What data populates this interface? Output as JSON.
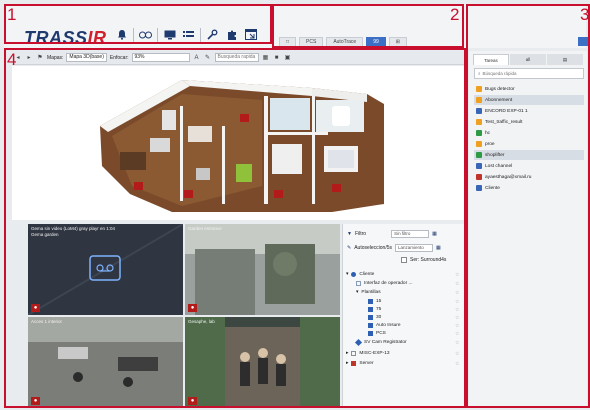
{
  "regions": {
    "r1": "1",
    "r2": "2",
    "r3": "3",
    "r4": "4"
  },
  "brand": {
    "logo_a": "TRASS",
    "logo_b": "IR"
  },
  "toolbar_icons": [
    "bell-icon",
    "link-icon",
    "monitor-icon",
    "list-icon",
    "wrench-icon",
    "puzzle-icon",
    "window-icon"
  ],
  "view_tabs": [
    {
      "label": "□",
      "active": false
    },
    {
      "label": "PCS",
      "active": false
    },
    {
      "label": "AutoTrace",
      "active": false
    },
    {
      "label": "99",
      "active": true
    },
    {
      "label": "⊞",
      "active": false
    }
  ],
  "viewbar": {
    "map_label": "Mapas:",
    "map_value": "Mapa 3D(base)",
    "scale_label": "Enfocar:",
    "scale_value": "93%",
    "search_placeholder": "Busqueda rapida"
  },
  "cameras": [
    {
      "title": "Gema sin video (LoM4) gray playr en 1:04",
      "subtitle": "Gema garden",
      "bg": "#2f3541"
    },
    {
      "title": "Garden entrance",
      "bg": "#7e8387"
    },
    {
      "title": "Acces 1 interior",
      "bg": "#6d6f6a"
    },
    {
      "title": "Gesaphe, lab",
      "bg": "#3c4741"
    }
  ],
  "filter": {
    "filter_label": "Filtro",
    "filter_value": "Sin filtro",
    "auto_label": "Autoseleccion/5s",
    "auto_value": "Lanzamiento",
    "checkbox_label": "Ser: Surround4s"
  },
  "tree": [
    {
      "label": "Cliente",
      "level": 0,
      "icon": "#2f5fb3"
    },
    {
      "label": "Interfaz de operador ...",
      "level": 1,
      "icon": "#8a9bb8"
    },
    {
      "label": "Plantillas",
      "level": 1,
      "icon": "#2f5fb3"
    },
    {
      "label": "15",
      "level": 2,
      "icon": "#2f5fb3"
    },
    {
      "label": "75",
      "level": 2,
      "icon": "#2f5fb3"
    },
    {
      "label": "30",
      "level": 2,
      "icon": "#2f5fb3"
    },
    {
      "label": "Auto Insure",
      "level": 2,
      "icon": "#2f5fb3"
    },
    {
      "label": "PCS",
      "level": 2,
      "icon": "#2f5fb3"
    },
    {
      "label": "SV Cam Registrator",
      "level": 1,
      "icon": "#2f5fb3"
    },
    {
      "label": "MISC-EXP-13",
      "level": 0,
      "icon": "#8a8f95"
    },
    {
      "label": "Server",
      "level": 0,
      "icon": "#c0352b"
    }
  ],
  "right_panel": {
    "tabs": [
      "Tareas",
      "all",
      "▤"
    ],
    "search_placeholder": "Búsqueda rápida",
    "items": [
      {
        "label": "Bugs detector",
        "icon": "#f0a020",
        "selected": false
      },
      {
        "label": "Abonnement",
        "icon": "#f0a020",
        "selected": true
      },
      {
        "label": "ENCORD EXP-01 1",
        "icon": "#3a66b8",
        "selected": false
      },
      {
        "label": "Test_traffic_result",
        "icon": "#f0a020",
        "selected": false
      },
      {
        "label": "hc",
        "icon": "#2e9a46",
        "selected": false
      },
      {
        "label": "proe",
        "icon": "#f0a020",
        "selected": false
      },
      {
        "label": "shoplifter",
        "icon": "#2e9a46",
        "selected": true
      },
      {
        "label": "Lost channel",
        "icon": "#3a66b8",
        "selected": false
      },
      {
        "label": "ayaesthaga@xmail.ru",
        "icon": "#c0352b",
        "selected": false
      },
      {
        "label": "Cliente",
        "icon": "#3a66b8",
        "selected": false
      }
    ]
  }
}
